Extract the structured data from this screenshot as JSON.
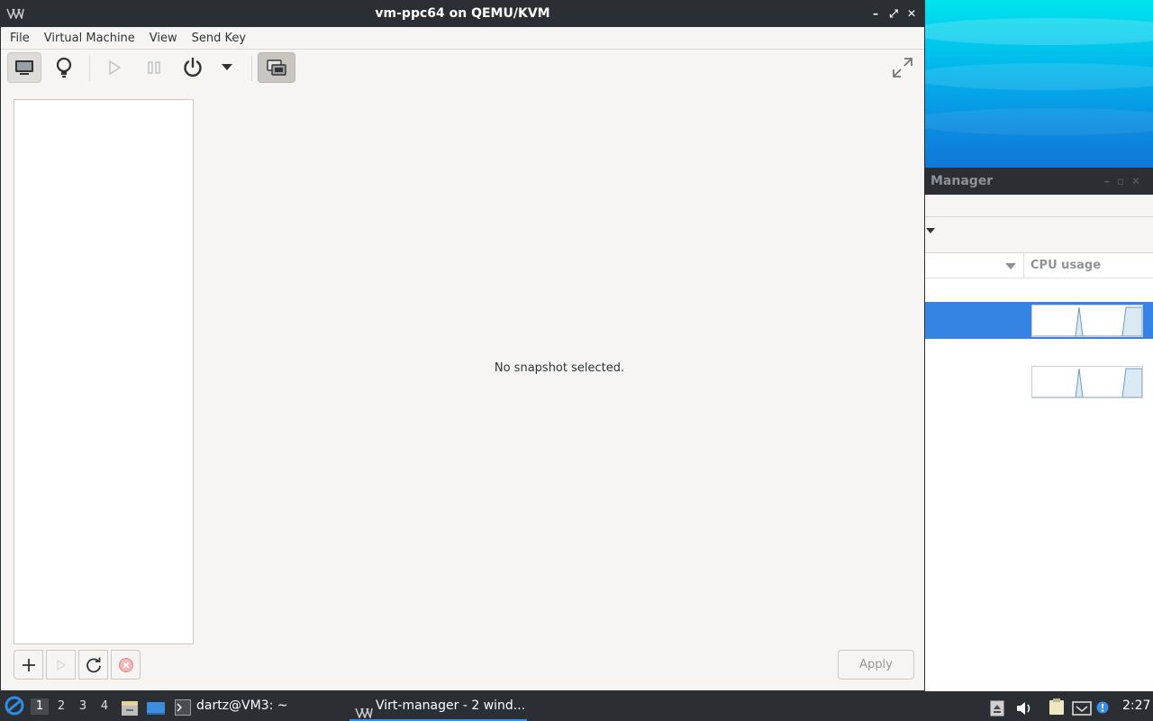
{
  "main_window": {
    "title": "vm-ppc64 on QEMU/KVM",
    "menu": [
      "File",
      "Virtual Machine",
      "View",
      "Send Key"
    ],
    "toolbar": {
      "console_tooltip": "Show the graphical console",
      "details_tooltip": "Show virtual hardware details",
      "run_tooltip": "Run",
      "pause_tooltip": "Pause",
      "shutdown_tooltip": "Shut down",
      "snapshots_tooltip": "Manage VM snapshots",
      "fullscreen_tooltip": "Switch to fullscreen view"
    },
    "placeholder_text": "No snapshot selected.",
    "apply_label": "Apply"
  },
  "background_window": {
    "title": "Manager",
    "column_header": "CPU usage"
  },
  "taskbar": {
    "workspaces": [
      "1",
      "2",
      "3",
      "4"
    ],
    "current_workspace": "1",
    "terminal_task": "dartz@VM3: ~",
    "virt_task": "Virt-manager - 2 wind...",
    "clock": "2:27"
  },
  "colors": {
    "titlebar": "#2b2e33",
    "window_bg": "#f6f5f4",
    "selection": "#3584e4",
    "taskbar_accent": "#3a8ee6"
  }
}
